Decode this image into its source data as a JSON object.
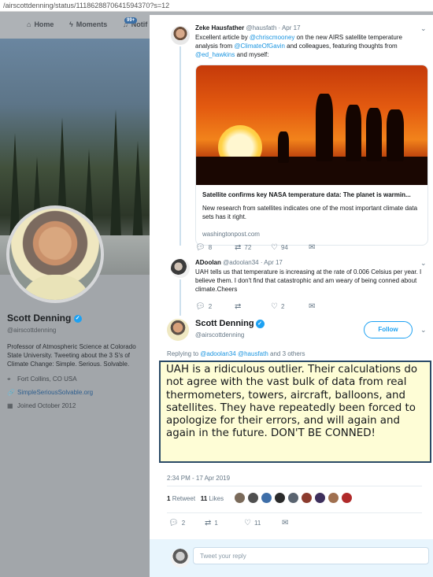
{
  "url": "/airscottdenning/status/1118628870641594370?s=12",
  "nav": {
    "home": "Home",
    "moments": "Moments",
    "notifications": "Notif",
    "badge": "99+"
  },
  "profile": {
    "name": "Scott Denning",
    "handle": "@airscottdenning",
    "bio": "Professor of Atmospheric Science at Colorado State University. Tweeting about the 3 S's of Climate Change: Simple. Serious. Solvable.",
    "location": "Fort Collins, CO USA",
    "website": "SimpleSeriousSolvable.org",
    "joined": "Joined October 2012"
  },
  "tweet1": {
    "name": "Zeke Hausfather",
    "handle": "@hausfath · Apr 17",
    "text_before": "Excellent article by ",
    "m1": "@chriscmooney",
    "text_mid1": " on the new AIRS satellite temperature analysis from ",
    "m2": "@ClimateOfGavin",
    "text_mid2": " and colleagues, featuring thoughts from ",
    "m3": "@ed_hawkins",
    "text_after": " and myself:",
    "card_title": "Satellite confirms key NASA temperature data: The planet is warmin...",
    "card_desc": "New research from satellites indicates one of the most important climate data sets has it right.",
    "card_domain": "washingtonpost.com",
    "replies": "8",
    "retweets": "72",
    "likes": "94"
  },
  "tweet2": {
    "name": "ADoolan",
    "handle": "@adoolan34 · Apr 17",
    "text": "UAH tells us that temperature is increasing at the rate of 0.006 Celsius per year. I believe them. I don't find that catastrophic and am weary of being conned about climate.Cheers",
    "replies": "2",
    "retweets": "",
    "likes": "2"
  },
  "main": {
    "name": "Scott Denning",
    "handle": "@airscottdenning",
    "follow": "Follow",
    "replying_prefix": "Replying to ",
    "reply_m1": "@adoolan34",
    "reply_m2": "@hausfath",
    "reply_suffix": " and 3 others",
    "text": "UAH is a ridiculous outlier. Their calculations do not agree with the vast bulk of data from real thermometers, towers, aircraft, balloons, and satellites. They have repeatedly been forced to apologize for their errors, and will again and again in the future. DON'T BE CONNED!",
    "timestamp": "2:34 PM - 17 Apr 2019",
    "retweet_count": "1",
    "retweet_label": "Retweet",
    "like_count": "11",
    "like_label": "Likes",
    "replies": "2",
    "retweets": "1",
    "likes": "11"
  },
  "reply_placeholder": "Tweet your reply",
  "colors": {
    "accent": "#1da1f2",
    "highlight_bg": "#fefdd6",
    "highlight_border": "#2a4a66"
  }
}
